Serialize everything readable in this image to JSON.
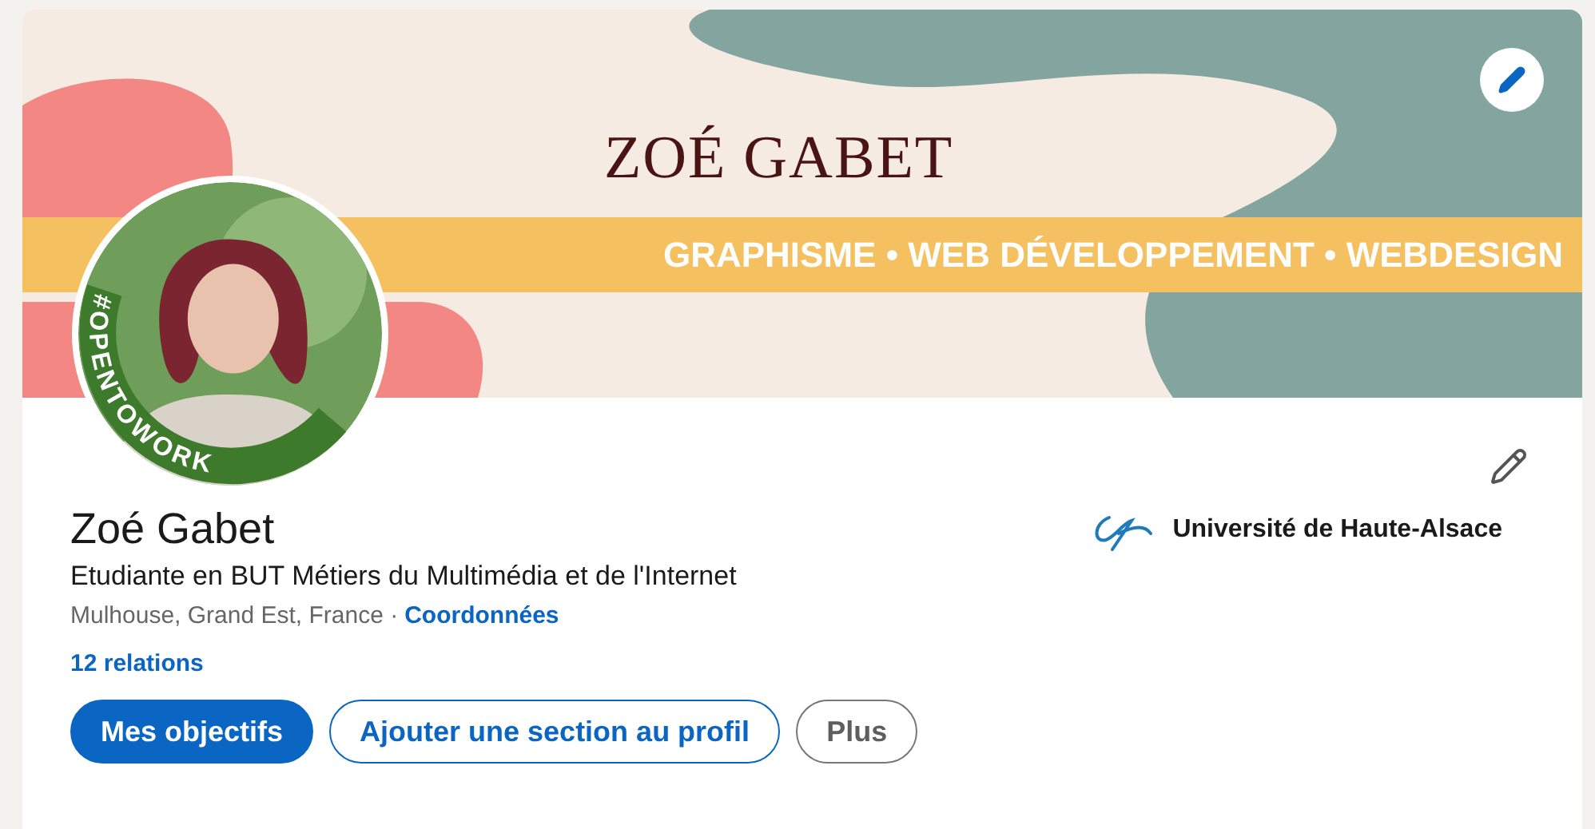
{
  "banner": {
    "title": "ZOÉ GABET",
    "tagline": "GRAPHISME • WEB DÉVELOPPEMENT • WEBDESIGN"
  },
  "avatar": {
    "badge": "#OPENTOWORK"
  },
  "profile": {
    "name": "Zoé Gabet",
    "headline": "Etudiante en BUT Métiers du Multimédia et de l'Internet",
    "location": "Mulhouse, Grand Est, France ·",
    "contact_link": "Coordonnées",
    "connections": "12 relations",
    "education": "Université de Haute-Alsace"
  },
  "buttons": [
    {
      "label": "Mes objectifs",
      "kind": "primary"
    },
    {
      "label": "Ajouter une section au profil",
      "kind": "outline"
    },
    {
      "label": "Plus",
      "kind": "secondary"
    }
  ]
}
